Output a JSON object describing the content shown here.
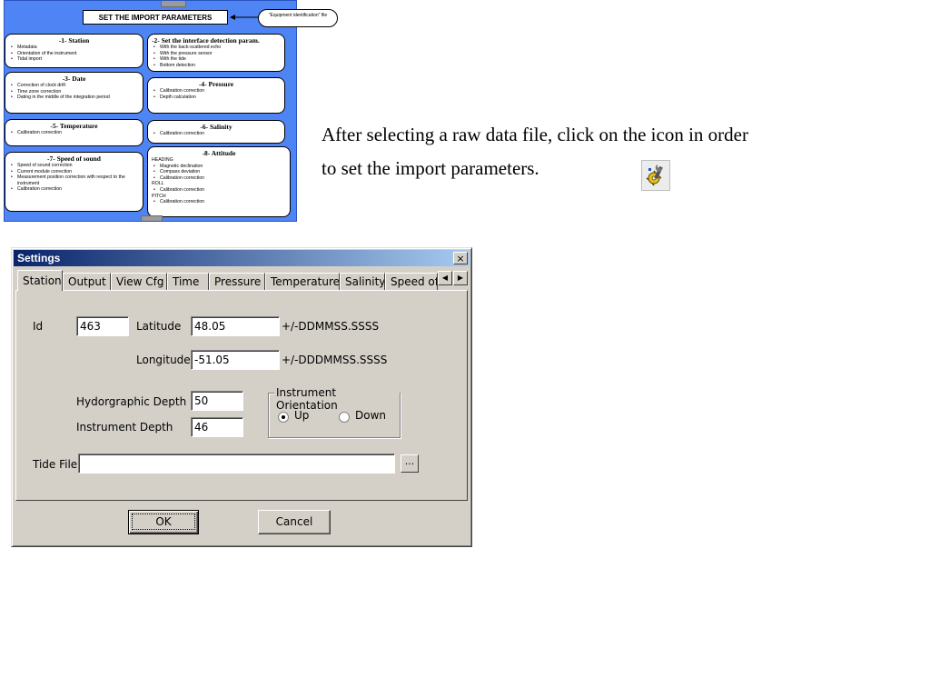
{
  "flowchart": {
    "title": "SET THE IMPORT PARAMETERS",
    "equipment_file": "\"Equipment identification\" file",
    "boxes": [
      {
        "title": "-1- Station",
        "items": [
          "Metadata",
          "Orientation of the instrument",
          "Tidal import"
        ]
      },
      {
        "title": "-2- Set the interface detection param.",
        "items": [
          "With the back-scattered echo",
          "With the pressure sensor",
          "With the tide",
          "Bottom detection"
        ]
      },
      {
        "title": "-3- Date",
        "items": [
          "Correction of clock drift",
          "Time zone correction",
          "Dating in the middle of the integration period"
        ]
      },
      {
        "title": "-4- Pressure",
        "items": [
          "Calibration correction",
          "Depth calculation"
        ]
      },
      {
        "title": "-5- Temperature",
        "items": [
          "Calibration correction"
        ]
      },
      {
        "title": "-6- Salinity",
        "items": [
          "Calibration correction"
        ]
      },
      {
        "title": "-7- Speed of sound",
        "items": [
          "Speed of sound correction",
          "Current module correction",
          "Measurement position correction with respect to the instrument",
          "Calibration correction"
        ]
      },
      {
        "title": "-8- Attitude",
        "heading_label": "HEADING",
        "heading_items": [
          "Magnetic declination",
          "Compass deviation",
          "Calibration correction"
        ],
        "roll_label": "ROLL",
        "roll_items": [
          "Calibration correction"
        ],
        "pitch_label": "PITCH",
        "pitch_items": [
          "Calibration correction"
        ]
      }
    ]
  },
  "instruction": {
    "line1": "After selecting a raw data file, click on the  icon in order",
    "line2": "to set the import parameters."
  },
  "dialog": {
    "title": "Settings",
    "close_glyph": "×",
    "tabs": [
      "Station",
      "Output",
      "View Cfg",
      "Time",
      "Pressure",
      "Temperature",
      "Salinity",
      "Speed of S"
    ],
    "active_tab": "Station",
    "scroll_left": "◀",
    "scroll_right": "▶",
    "fields": {
      "id_label": "Id",
      "id_value": "463",
      "latitude_label": "Latitude",
      "latitude_value": "48.05",
      "latitude_format": "+/-DDMMSS.SSSS",
      "longitude_label": "Longitude",
      "longitude_value": "-51.05",
      "longitude_format": "+/-DDDMMSS.SSSS",
      "hydro_depth_label": "Hydorgraphic Depth",
      "hydro_depth_value": "50",
      "instrument_depth_label": "Instrument Depth",
      "instrument_depth_value": "46",
      "tide_file_label": "Tide File",
      "tide_file_value": "",
      "browse_label": "..."
    },
    "orientation": {
      "legend": "Instrument Orientation",
      "options": [
        "Up",
        "Down"
      ],
      "selected": "Up"
    },
    "buttons": {
      "ok": "OK",
      "cancel": "Cancel"
    }
  }
}
